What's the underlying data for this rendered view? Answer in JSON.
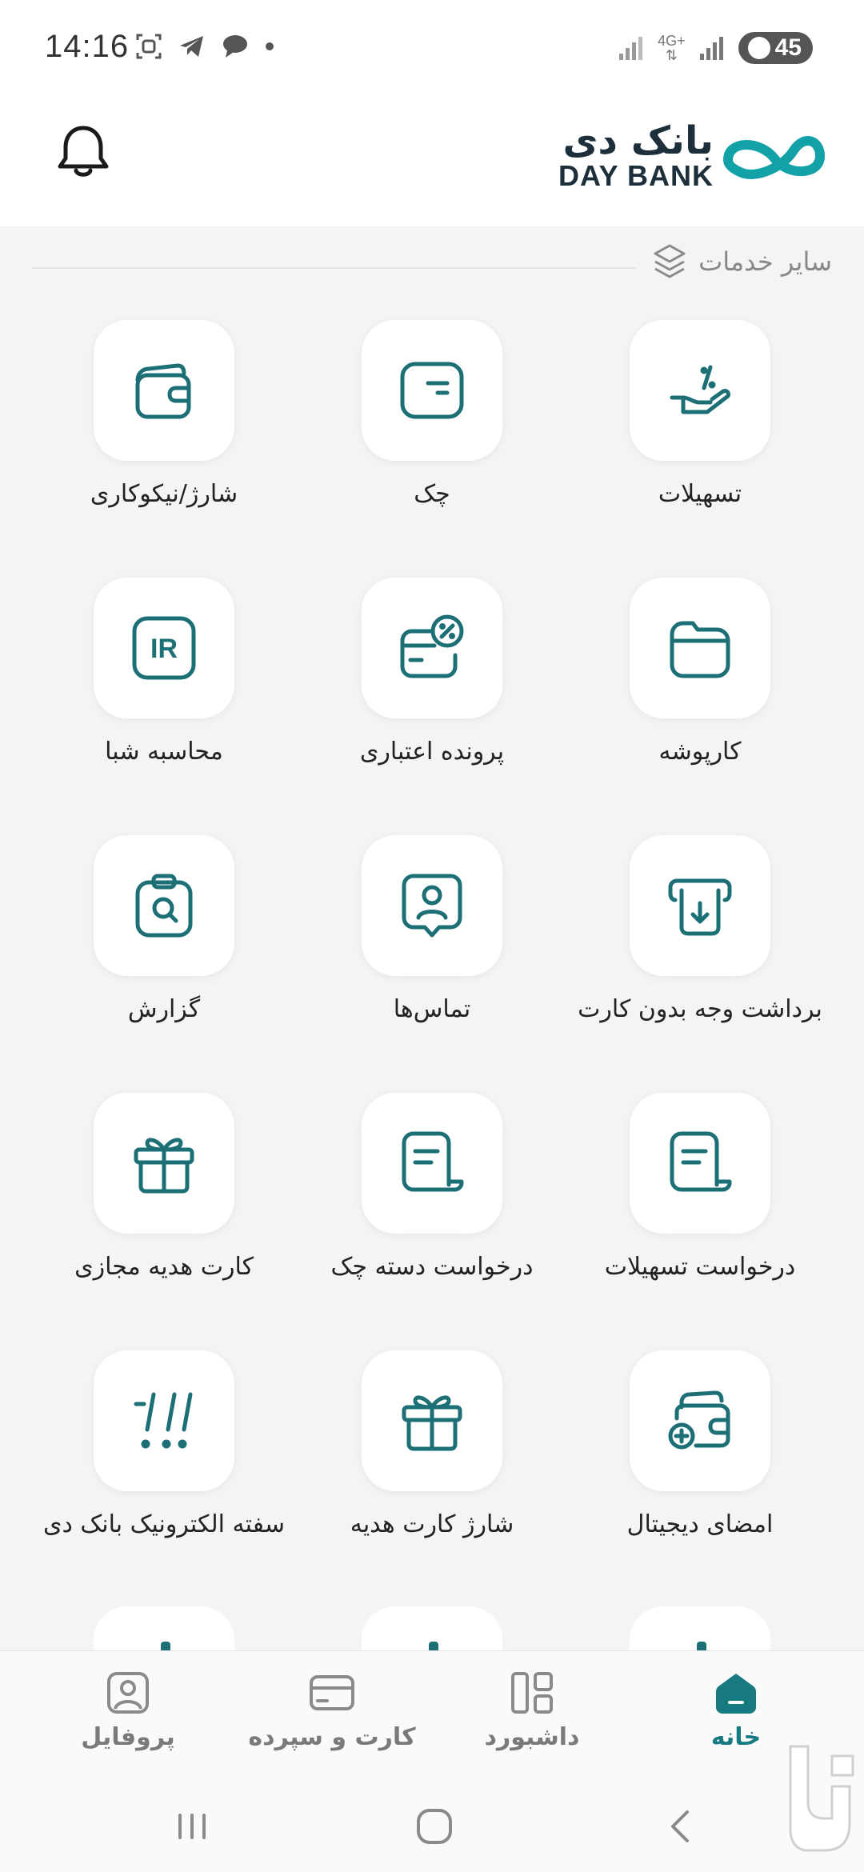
{
  "status_bar": {
    "time": "14:16",
    "network": "4G+",
    "battery": "45"
  },
  "header": {
    "logo_fa": "بانک دی",
    "logo_en": "DAY BANK"
  },
  "section": {
    "title": "سایر خدمات"
  },
  "services": [
    {
      "label": "تسهیلات",
      "icon": "loan-hand-icon"
    },
    {
      "label": "چک",
      "icon": "cheque-icon"
    },
    {
      "label": "شارژ/نیکوکاری",
      "icon": "wallet-icon"
    },
    {
      "label": "کارپوشه",
      "icon": "folder-icon"
    },
    {
      "label": "پرونده اعتباری",
      "icon": "credit-file-icon"
    },
    {
      "label": "محاسبه شبا",
      "icon": "iban-ir-icon"
    },
    {
      "label": "برداشت وجه بدون کارت",
      "icon": "cardless-withdraw-icon"
    },
    {
      "label": "تماس‌ها",
      "icon": "contacts-icon"
    },
    {
      "label": "گزارش",
      "icon": "report-icon"
    },
    {
      "label": "درخواست تسهیلات",
      "icon": "loan-request-icon"
    },
    {
      "label": "درخواست دسته چک",
      "icon": "chequebook-request-icon"
    },
    {
      "label": "کارت هدیه مجازی",
      "icon": "gift-icon"
    },
    {
      "label": "امضای دیجیتال",
      "icon": "digital-signature-icon"
    },
    {
      "label": "شارژ کارت هدیه",
      "icon": "gift-charge-icon"
    },
    {
      "label": "سفته الکترونیک بانک دی",
      "icon": "promissory-note-icon"
    }
  ],
  "bottom_nav": [
    {
      "label": "خانه",
      "icon": "home-icon",
      "active": true
    },
    {
      "label": "داشبورد",
      "icon": "dashboard-icon",
      "active": false
    },
    {
      "label": "کارت و سپرده",
      "icon": "card-icon",
      "active": false
    },
    {
      "label": "پروفایل",
      "icon": "profile-icon",
      "active": false
    }
  ],
  "colors": {
    "accent": "#167a80",
    "icon": "#1d6f76",
    "background": "#f4f4f4"
  }
}
